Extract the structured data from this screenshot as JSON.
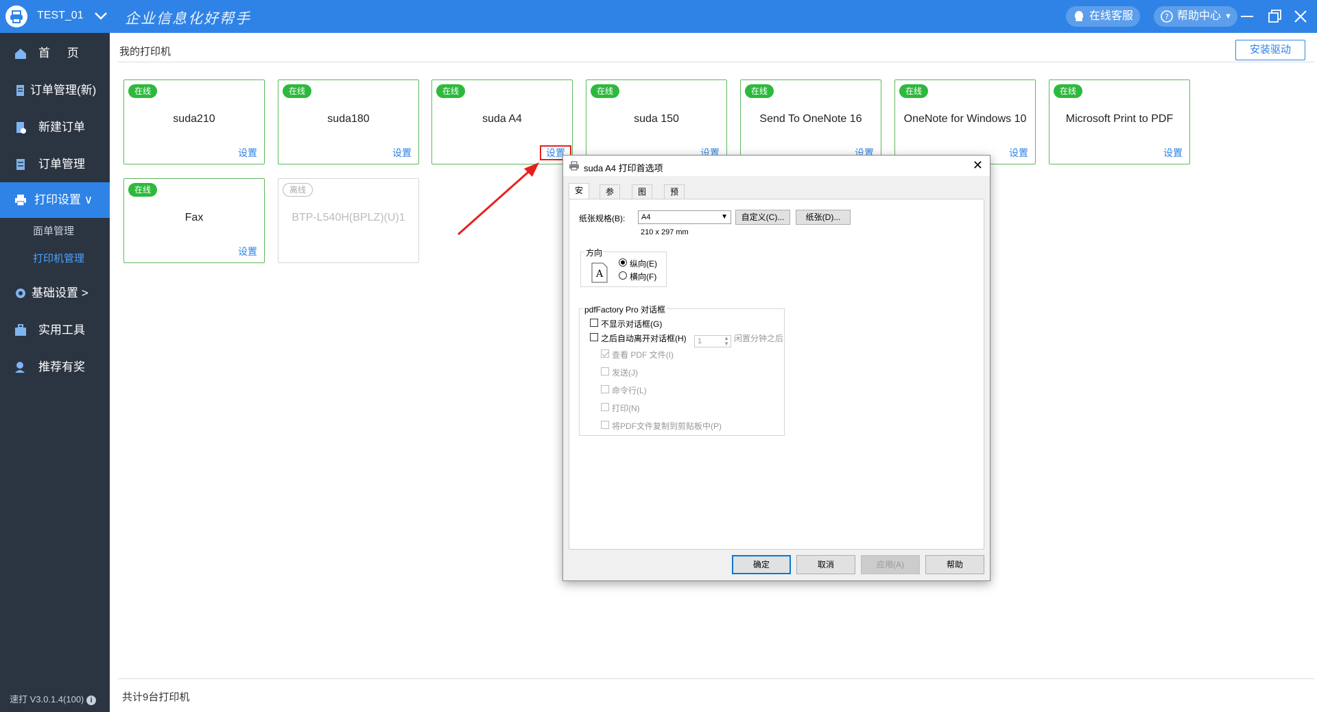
{
  "app": {
    "username": "TEST_01",
    "slogan": "企业信息化好帮手",
    "service_label": "在线客服",
    "help_label": "帮助中心",
    "version": "速打 V3.0.1.4(100)"
  },
  "sidebar": {
    "items": [
      {
        "label": "首 页",
        "icon": "home-icon"
      },
      {
        "label": "订单管理(新)",
        "icon": "document-icon"
      },
      {
        "label": "新建订单",
        "icon": "new-order-icon"
      },
      {
        "label": "订单管理",
        "icon": "order-list-icon"
      },
      {
        "label": "打印设置 ∨",
        "icon": "printer-icon"
      },
      {
        "label": "基础设置 >",
        "icon": "gear-icon"
      },
      {
        "label": "实用工具",
        "icon": "toolbox-icon"
      },
      {
        "label": "推荐有奖",
        "icon": "user-reward-icon"
      }
    ],
    "subitems": [
      "面单管理",
      "打印机管理"
    ]
  },
  "main": {
    "title": "我的打印机",
    "install_button": "安装驱动",
    "online_label": "在线",
    "offline_label": "离线",
    "settings_label": "设置",
    "printers": [
      {
        "name": "suda210",
        "status": "在线"
      },
      {
        "name": "suda180",
        "status": "在线"
      },
      {
        "name": "suda A4",
        "status": "在线"
      },
      {
        "name": "suda 150",
        "status": "在线"
      },
      {
        "name": "Send To OneNote 16",
        "status": "在线"
      },
      {
        "name": "OneNote for Windows 10",
        "status": "在线"
      },
      {
        "name": "Microsoft Print to PDF",
        "status": "在线"
      },
      {
        "name": "Fax",
        "status": "在线"
      },
      {
        "name": "BTP-L540H(BPLZ)(U)1",
        "status": "离线"
      }
    ],
    "total": "共计9台打印机"
  },
  "dialog": {
    "title": "suda A4 打印首选项",
    "tabs": [
      "安装",
      "参数",
      "图形",
      "预览"
    ],
    "paper_label": "纸张规格(B):",
    "paper_value": "A4",
    "paper_size": "210 x 297 mm",
    "custom_button": "自定义(C)...",
    "paper_button": "纸张(D)...",
    "orientation_label": "方向",
    "portrait": "纵向(E)",
    "landscape": "横向(F)",
    "group_label": "pdfFactory Pro 对话框",
    "no_dialog": "不显示对话框(G)",
    "auto_close": "之后自动离开对话框(H)",
    "spin_value": "1",
    "idle_after": "闲置分钟之后",
    "view_pdf": "查看 PDF 文件(I)",
    "send": "发送(J)",
    "command": "命令行(L)",
    "print": "打印(N)",
    "copy_clipboard": "将PDF文件复制到剪贴板中(P)",
    "ok": "确定",
    "cancel": "取消",
    "apply": "应用(A)",
    "help": "帮助"
  },
  "colors": {
    "accent": "#2f83e6",
    "sidebar": "#2b3441",
    "online": "#2db93d",
    "highlight": "#e8201c"
  }
}
